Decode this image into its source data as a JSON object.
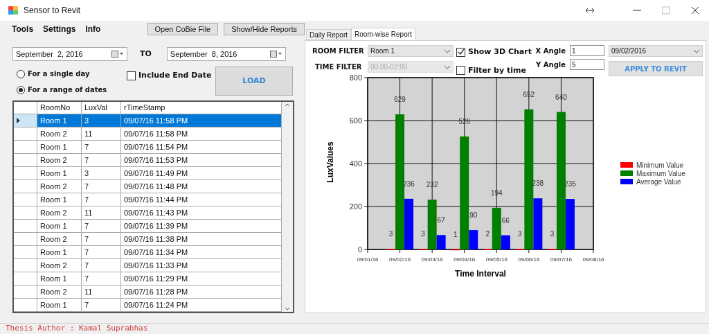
{
  "window": {
    "title": "Sensor to Revit"
  },
  "menu": [
    {
      "label": "Tools"
    },
    {
      "label": "Settings"
    },
    {
      "label": "Info"
    }
  ],
  "toolbar_buttons": [
    "Open CoBie File",
    "Show/Hide Reports"
  ],
  "date_from": "September  2, 2016",
  "to_label": "TO",
  "date_to": "September  8, 2016",
  "radios": [
    {
      "label": "For a single day",
      "selected": false
    },
    {
      "label": "For a range of dates",
      "selected": true
    }
  ],
  "include_end_date": {
    "label": "Include End Date",
    "checked": false
  },
  "load_button": "LOAD",
  "table": {
    "columns": [
      "RoomNo",
      "LuxVal",
      "rTimeStamp"
    ],
    "rows": [
      {
        "cells": [
          "Room 1",
          "3",
          "09/07/16 11:58 PM"
        ],
        "selected": true
      },
      {
        "cells": [
          "Room 2",
          "11",
          "09/07/16 11:58 PM"
        ],
        "selected": false
      },
      {
        "cells": [
          "Room 1",
          "7",
          "09/07/16 11:54 PM"
        ],
        "selected": false
      },
      {
        "cells": [
          "Room 2",
          "7",
          "09/07/16 11:53 PM"
        ],
        "selected": false
      },
      {
        "cells": [
          "Room 1",
          "3",
          "09/07/16 11:49 PM"
        ],
        "selected": false
      },
      {
        "cells": [
          "Room 2",
          "7",
          "09/07/16 11:48 PM"
        ],
        "selected": false
      },
      {
        "cells": [
          "Room 1",
          "7",
          "09/07/16 11:44 PM"
        ],
        "selected": false
      },
      {
        "cells": [
          "Room 2",
          "11",
          "09/07/16 11:43 PM"
        ],
        "selected": false
      },
      {
        "cells": [
          "Room 1",
          "7",
          "09/07/16 11:39 PM"
        ],
        "selected": false
      },
      {
        "cells": [
          "Room 2",
          "7",
          "09/07/16 11:38 PM"
        ],
        "selected": false
      },
      {
        "cells": [
          "Room 1",
          "7",
          "09/07/16 11:34 PM"
        ],
        "selected": false
      },
      {
        "cells": [
          "Room 2",
          "7",
          "09/07/16 11:33 PM"
        ],
        "selected": false
      },
      {
        "cells": [
          "Room 1",
          "7",
          "09/07/16 11:29 PM"
        ],
        "selected": false
      },
      {
        "cells": [
          "Room 2",
          "11",
          "09/07/16 11:28 PM"
        ],
        "selected": false
      },
      {
        "cells": [
          "Room 1",
          "7",
          "09/07/16 11:24 PM"
        ],
        "selected": false
      }
    ]
  },
  "tabs": [
    {
      "label": "Daily Report",
      "selected": false
    },
    {
      "label": "Room-wise Report",
      "selected": true
    }
  ],
  "room_filter": {
    "label": "ROOM FILTER",
    "value": "Room 1"
  },
  "time_filter": {
    "label": "TIME FILTER",
    "value": "00:00-02:00",
    "disabled": true
  },
  "show_3d_chart": {
    "label": "Show 3D Chart",
    "checked": true
  },
  "filter_by_time": {
    "label": "Filter by time",
    "checked": false
  },
  "x_angle": {
    "label": "X Angle",
    "value": "1"
  },
  "y_angle": {
    "label": "Y Angle",
    "value": "5"
  },
  "date_select": {
    "value": "09/02/2016"
  },
  "apply_button": "APPLY TO REVIT",
  "chart_data": {
    "type": "bar",
    "xlabel": "Time Interval",
    "ylabel": "LuxValues",
    "categories": [
      "09/01/16",
      "09/02/16",
      "09/03/16",
      "09/04/16",
      "09/05/16",
      "09/06/16",
      "09/07/16",
      "09/08/16"
    ],
    "series": [
      {
        "name": "Minimum Value",
        "color": "#ff0000",
        "values": [
          null,
          3,
          3,
          1,
          2,
          3,
          3,
          null
        ]
      },
      {
        "name": "Maximum Value",
        "color": "#008000",
        "values": [
          null,
          629,
          232,
          526,
          194,
          652,
          640,
          null
        ]
      },
      {
        "name": "Average Value",
        "color": "#0000ff",
        "values": [
          null,
          236,
          67,
          90,
          66,
          238,
          235,
          null
        ]
      }
    ],
    "yticks": [
      0,
      200,
      400,
      600,
      800
    ],
    "ylim": [
      0,
      800
    ],
    "data_labels": true,
    "grid": true,
    "legend": true
  },
  "footer": "Thesis Author : Kamal Suprabhas"
}
